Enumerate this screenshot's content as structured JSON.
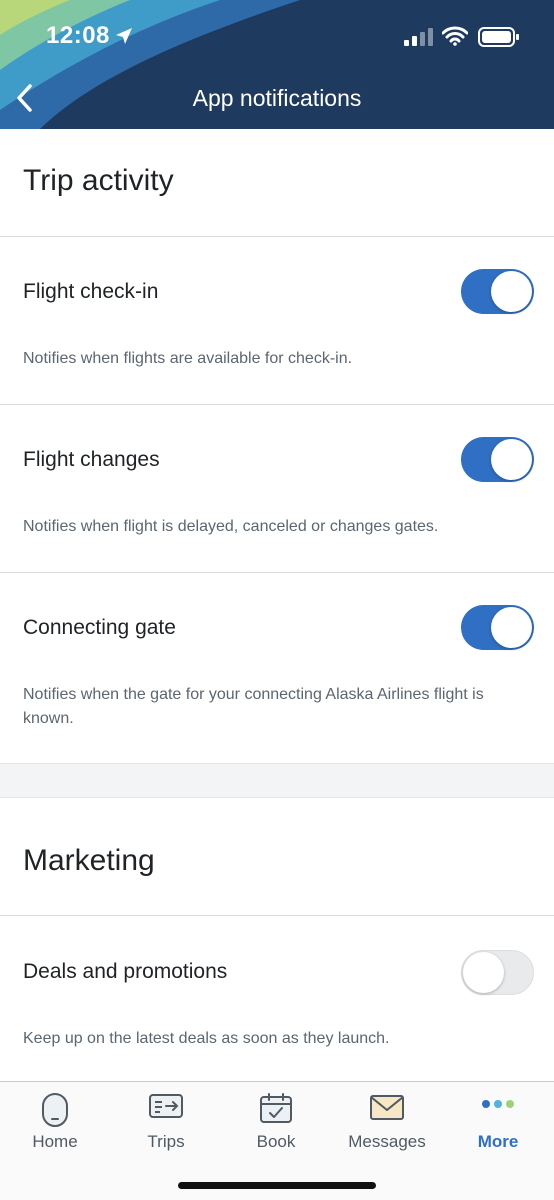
{
  "status_bar": {
    "time": "12:08"
  },
  "header": {
    "title": "App notifications"
  },
  "sections": [
    {
      "title": "Trip activity",
      "rows": [
        {
          "label": "Flight check-in",
          "description": "Notifies when flights are available for check-in.",
          "enabled": true
        },
        {
          "label": "Flight changes",
          "description": "Notifies when flight is delayed, canceled or changes gates.",
          "enabled": true
        },
        {
          "label": "Connecting gate",
          "description": "Notifies when the gate for your connecting Alaska Airlines flight is known.",
          "enabled": true
        }
      ]
    },
    {
      "title": "Marketing",
      "rows": [
        {
          "label": "Deals and promotions",
          "description": "Keep up on the latest deals as soon as they launch.",
          "enabled": false
        }
      ]
    }
  ],
  "tabbar": {
    "items": [
      {
        "label": "Home",
        "icon": "home-icon"
      },
      {
        "label": "Trips",
        "icon": "trips-icon"
      },
      {
        "label": "Book",
        "icon": "book-calendar-icon"
      },
      {
        "label": "Messages",
        "icon": "messages-envelope-icon"
      },
      {
        "label": "More",
        "icon": "more-dots-icon",
        "active": true
      }
    ]
  },
  "colors": {
    "header": "#1e3a5f",
    "accent": "#2f6fc4",
    "toggle_off": "#e9eaec"
  }
}
